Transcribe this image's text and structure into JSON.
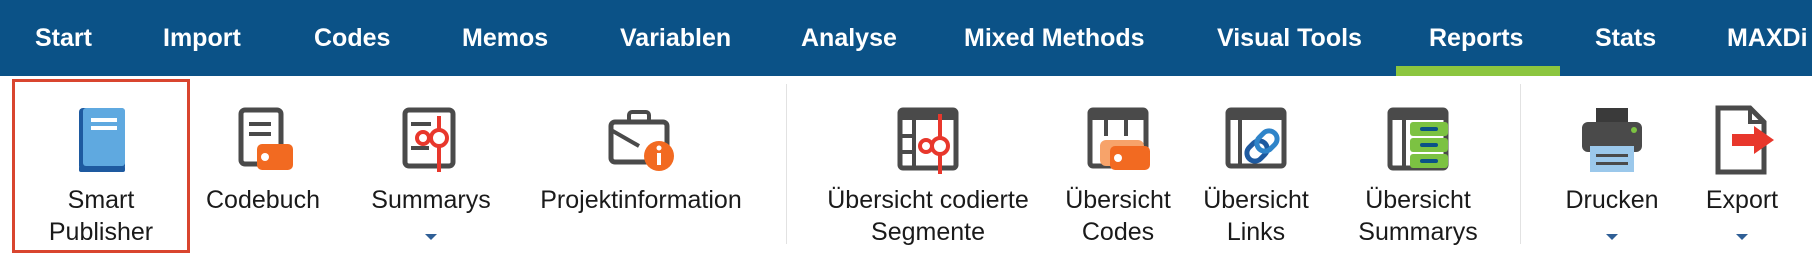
{
  "menubar": {
    "tabs": [
      {
        "label": "Start"
      },
      {
        "label": "Import"
      },
      {
        "label": "Codes"
      },
      {
        "label": "Memos"
      },
      {
        "label": "Variablen"
      },
      {
        "label": "Analyse"
      },
      {
        "label": "Mixed Methods"
      },
      {
        "label": "Visual Tools"
      },
      {
        "label": "Reports"
      },
      {
        "label": "Stats"
      },
      {
        "label": "MAXDi"
      }
    ],
    "active_tab": "Reports",
    "active_underline_color": "#8cc63f",
    "background_color": "#0b5287"
  },
  "ribbon": {
    "buttons": [
      {
        "line1": "Smart",
        "line2": "Publisher",
        "icon": "book-icon"
      },
      {
        "line1": "Codebuch",
        "icon": "codebook-icon"
      },
      {
        "line1": "Summarys",
        "icon": "summary-icon"
      },
      {
        "line1": "Projektinformation",
        "icon": "project-info-icon"
      },
      {
        "line1": "Übersicht codierte",
        "line2": "Segmente",
        "icon": "coded-segments-table-icon"
      },
      {
        "line1": "Übersicht",
        "line2": "Codes",
        "icon": "codes-table-icon"
      },
      {
        "line1": "Übersicht",
        "line2": "Links",
        "icon": "links-table-icon"
      },
      {
        "line1": "Übersicht",
        "line2": "Summarys",
        "icon": "summarys-table-icon"
      },
      {
        "line1": "Drucken",
        "icon": "printer-icon"
      },
      {
        "line1": "Export",
        "icon": "export-icon"
      }
    ],
    "selected_button": "Smart Publisher",
    "selection_color": "#d9452f"
  }
}
